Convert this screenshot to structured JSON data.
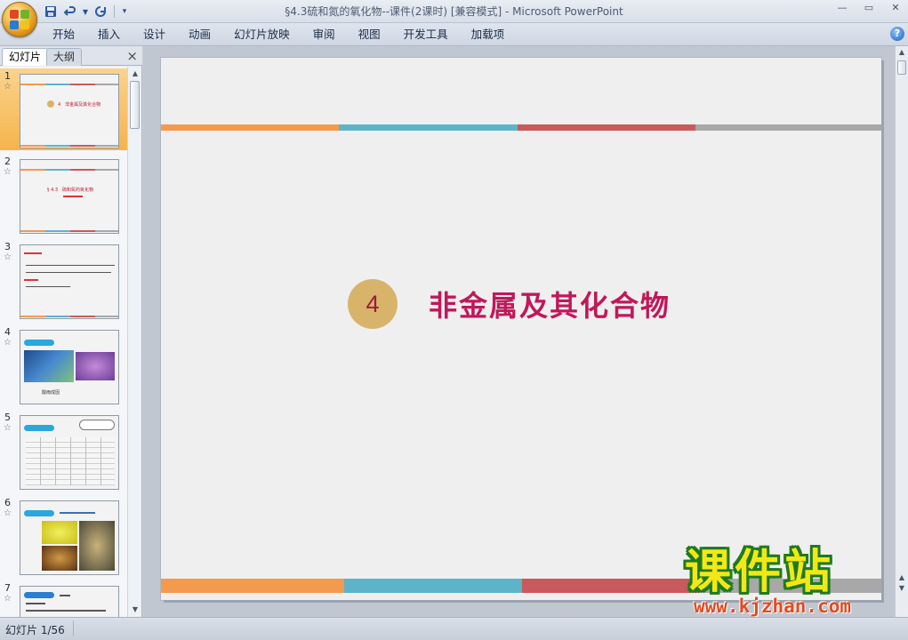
{
  "window": {
    "title": "§4.3硫和氮的氧化物--课件(2课时) [兼容模式] - Microsoft PowerPoint"
  },
  "quick_access": {
    "icons": [
      "save-icon",
      "undo-icon",
      "redo-icon",
      "customize-icon"
    ]
  },
  "ribbon": {
    "tabs": [
      "开始",
      "插入",
      "设计",
      "动画",
      "幻灯片放映",
      "审阅",
      "视图",
      "开发工具",
      "加载项"
    ],
    "help": "?"
  },
  "panel": {
    "tab_slides": "幻灯片",
    "tab_outline": "大纲",
    "close": "×"
  },
  "thumbnails": [
    {
      "num": "1",
      "star": "☆",
      "text": "4　非金属及其化合物"
    },
    {
      "num": "2",
      "star": "☆",
      "text": "§ 4.3　硫和氮的氧化物"
    },
    {
      "num": "3",
      "star": "☆",
      "text": ""
    },
    {
      "num": "4",
      "star": "☆",
      "text": "酸雨成因"
    },
    {
      "num": "5",
      "star": "☆",
      "text": ""
    },
    {
      "num": "6",
      "star": "☆",
      "text": ""
    },
    {
      "num": "7",
      "star": "☆",
      "text": ""
    }
  ],
  "slide": {
    "number": "4",
    "title": "非金属及其化合物"
  },
  "colors": {
    "orange": "#f39a4c",
    "teal": "#5db4c8",
    "red": "#c9595a",
    "gray": "#a8a8a8",
    "title": "#c0185a",
    "circle": "#d8b46b"
  },
  "watermark": {
    "title": "课件站",
    "url": "www.kjzhan.com"
  },
  "status": {
    "slide_info": "幻灯片 1/56"
  }
}
